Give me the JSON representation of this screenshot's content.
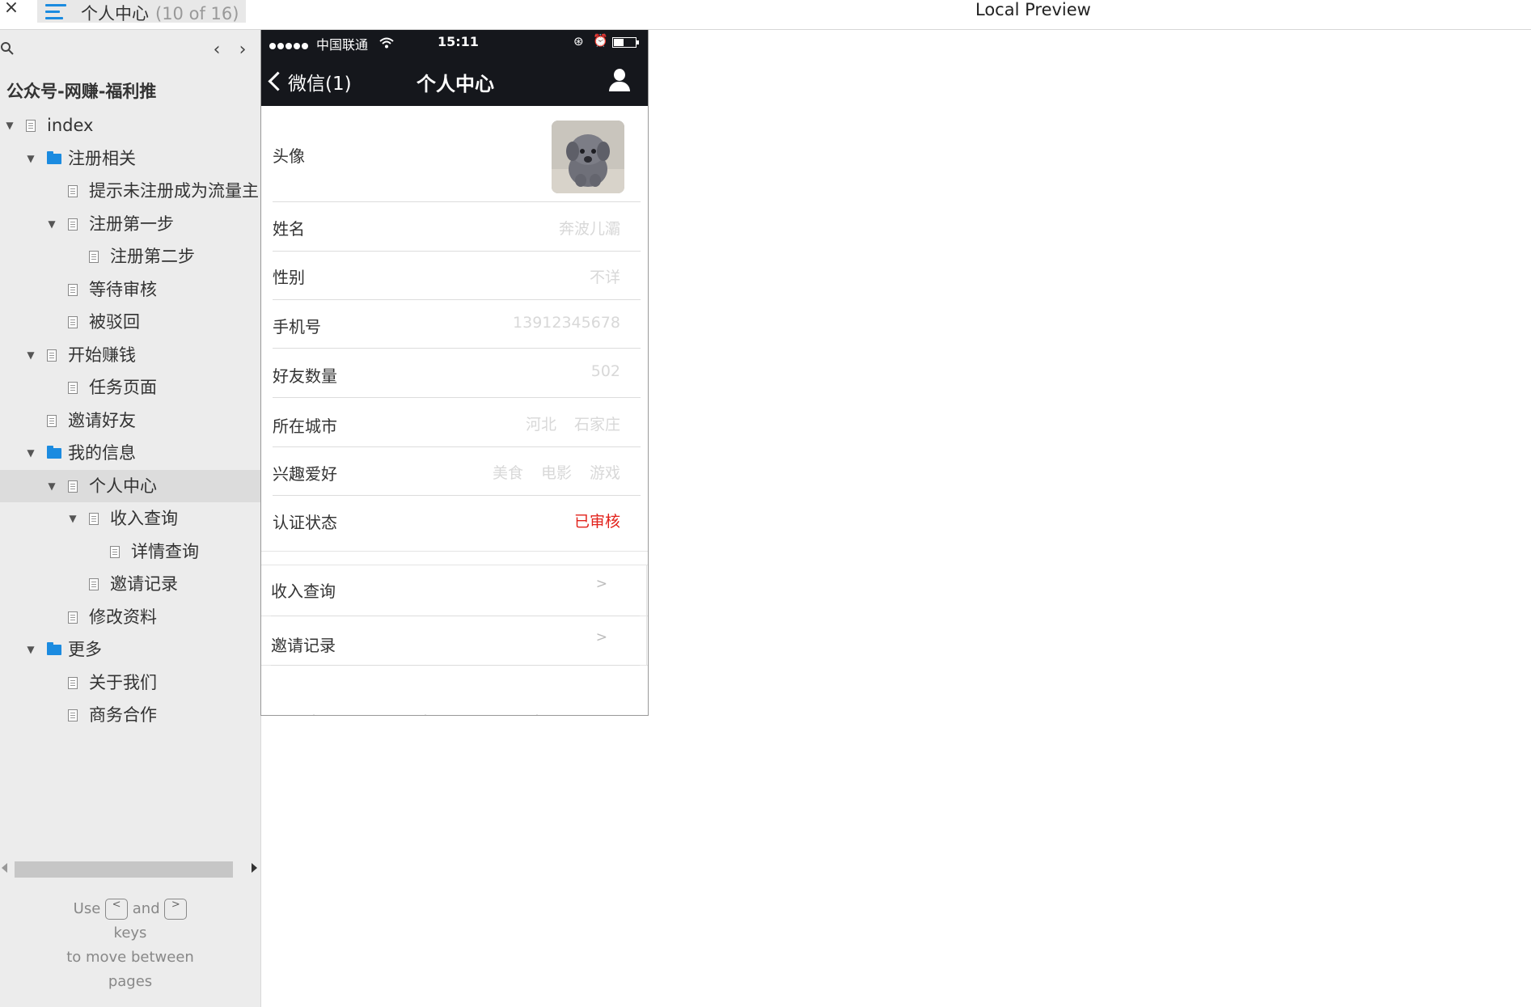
{
  "topbar": {
    "close_glyph": "×",
    "page_title": "个人中心",
    "page_count": "(10 of 16)",
    "preview_title": "Local Preview"
  },
  "sidebar": {
    "project_title": "公众号-网赚-福利推",
    "nav_prev_glyph": "‹",
    "nav_next_glyph": "›",
    "tree": [
      {
        "label": "index",
        "level": 0,
        "type": "page",
        "expanded": true
      },
      {
        "label": "注册相关",
        "level": 1,
        "type": "folder",
        "expanded": true
      },
      {
        "label": "提示未注册成为流量主",
        "level": 2,
        "type": "page"
      },
      {
        "label": "注册第一步",
        "level": 2,
        "type": "page",
        "expanded": true
      },
      {
        "label": "注册第二步",
        "level": 3,
        "type": "page"
      },
      {
        "label": "等待审核",
        "level": 2,
        "type": "page"
      },
      {
        "label": "被驳回",
        "level": 2,
        "type": "page"
      },
      {
        "label": "开始赚钱",
        "level": 1,
        "type": "page",
        "expanded": true
      },
      {
        "label": "任务页面",
        "level": 2,
        "type": "page"
      },
      {
        "label": "邀请好友",
        "level": 1,
        "type": "page"
      },
      {
        "label": "我的信息",
        "level": 1,
        "type": "folder",
        "expanded": true
      },
      {
        "label": "个人中心",
        "level": 2,
        "type": "page",
        "expanded": true,
        "selected": true
      },
      {
        "label": "收入查询",
        "level": 3,
        "type": "page",
        "expanded": true
      },
      {
        "label": "详情查询",
        "level": 4,
        "type": "page"
      },
      {
        "label": "邀请记录",
        "level": 3,
        "type": "page"
      },
      {
        "label": "修改资料",
        "level": 2,
        "type": "page"
      },
      {
        "label": "更多",
        "level": 1,
        "type": "folder",
        "expanded": true
      },
      {
        "label": "关于我们",
        "level": 2,
        "type": "page"
      },
      {
        "label": "商务合作",
        "level": 2,
        "type": "page"
      }
    ],
    "hint": {
      "use": "Use",
      "prev_key": "<",
      "and": "and",
      "next_key": ">",
      "keys": "keys",
      "line2": "to move between",
      "line3": "pages"
    }
  },
  "phone": {
    "status": {
      "carrier": "中国联通",
      "wifi_glyph": "⊘",
      "time": "15:11",
      "lock_glyph": "⊛",
      "alarm_glyph": "⏰",
      "battery_level": 0.45
    },
    "nav": {
      "back_label": "微信(1)",
      "title": "个人中心"
    },
    "profile": {
      "avatar_label": "头像",
      "name_label": "姓名",
      "name_value": "奔波儿灞",
      "gender_label": "性别",
      "gender_value": "不详",
      "phone_label": "手机号",
      "phone_value": "13912345678",
      "friends_label": "好友数量",
      "friends_value": "502",
      "city_label": "所在城市",
      "city_province": "河北",
      "city_name": "石家庄",
      "hobby_label": "兴趣爱好",
      "hobbies": [
        "美食",
        "电影",
        "游戏"
      ],
      "status_label": "认证状态",
      "status_value": "已审核",
      "status_color": "#e2221b"
    },
    "links": {
      "income_label": "收入查询",
      "invite_label": "邀请记录",
      "arrow": ">"
    }
  }
}
